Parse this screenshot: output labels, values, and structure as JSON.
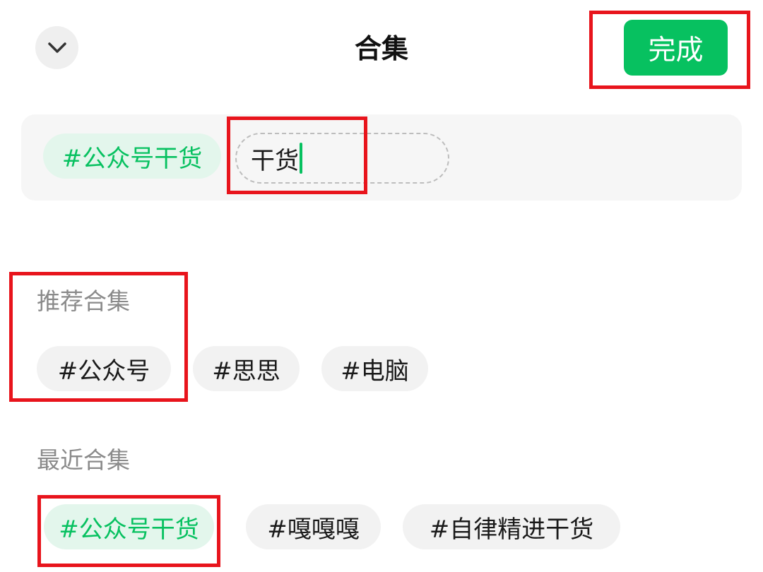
{
  "header": {
    "title": "合集",
    "collapse_icon": "chevron-down-icon",
    "done_label": "完成"
  },
  "selected": {
    "tags": [
      "#公众号干货"
    ],
    "input_value": "干货"
  },
  "recommended": {
    "label": "推荐合集",
    "tags": [
      "#公众号",
      "#思思",
      "#电脑"
    ]
  },
  "recent": {
    "label": "最近合集",
    "tags": [
      "#公众号干货",
      "#嘎嘎嘎",
      "#自律精进干货"
    ]
  },
  "colors": {
    "accent": "#07c160",
    "accent_light": "#e3f6ec",
    "highlight": "#e8141c"
  }
}
